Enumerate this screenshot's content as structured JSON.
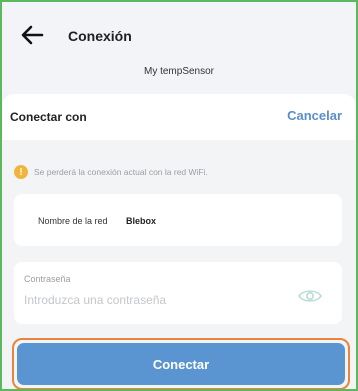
{
  "header": {
    "title": "Conexión",
    "device_name": "My tempSensor"
  },
  "sheet": {
    "title": "Conectar con",
    "cancel_label": "Cancelar",
    "warning_text": "Se perderá la conexión actual con la red WiFi.",
    "network_label": "Nombre de la red",
    "network_value": "Blebox",
    "password_label": "Contraseña",
    "password_placeholder": "Introduzca una contraseña",
    "password_value": "",
    "connect_label": "Conectar"
  },
  "icons": {
    "back": "back-arrow-icon",
    "warning": "warning-icon",
    "visibility": "eye-icon"
  },
  "colors": {
    "accent": "#5b95d1",
    "cancel": "#5a8fc9",
    "highlight_outline": "#e8843c",
    "frame_outline": "#5cb85c",
    "warning": "#f0b53a"
  }
}
